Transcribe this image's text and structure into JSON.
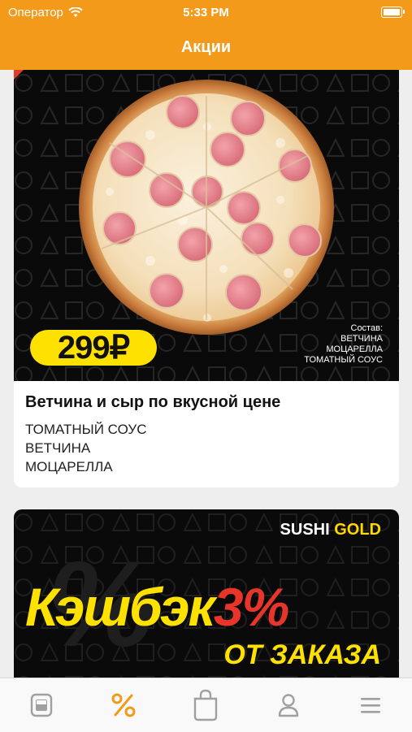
{
  "status_bar": {
    "carrier": "Оператор",
    "time": "5:33 PM"
  },
  "header": {
    "title": "Акции"
  },
  "promo_cards": [
    {
      "price": "299₽",
      "composition_label": "Состав:",
      "composition_items": [
        "ВЕТЧИНА",
        "МОЦАРЕЛЛА",
        "ТОМАТНЫЙ СОУС"
      ],
      "title": "Ветчина и сыр по вкусной цене",
      "ingredients": [
        "ТОМАТНЫЙ СОУС",
        "ВЕТЧИНА",
        "МОЦАРЕЛЛА"
      ]
    },
    {
      "brand_part1": "SUSHI",
      "brand_part2": "GOLD",
      "headline_word": "Кэшбэк",
      "headline_percent": "3%",
      "subline": "ОТ ЗАКАЗА",
      "background_glyph": "%"
    }
  ],
  "tab_bar": {
    "active_index": 1,
    "tabs": [
      {
        "icon": "menu-book-icon"
      },
      {
        "icon": "percent-icon"
      },
      {
        "icon": "cart-bag-icon"
      },
      {
        "icon": "profile-icon"
      },
      {
        "icon": "hamburger-icon"
      }
    ]
  },
  "colors": {
    "accent": "#f39a1b",
    "price_badge": "#ffe100",
    "cashback_red": "#e8352a",
    "inactive_icon": "#a0a0a0"
  }
}
